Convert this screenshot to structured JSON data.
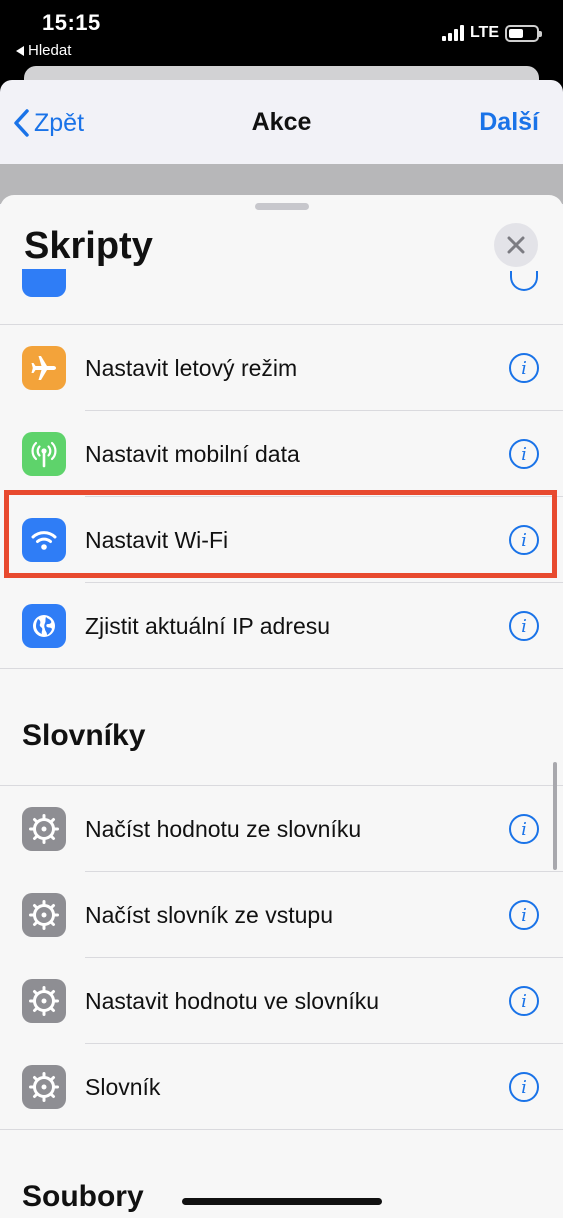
{
  "status_bar": {
    "time": "15:15",
    "back_app": "Hledat",
    "network": "LTE"
  },
  "nav": {
    "back_label": "Zpět",
    "title": "Akce",
    "next_label": "Další"
  },
  "sheet": {
    "title": "Skripty"
  },
  "sections": [
    {
      "items": [
        {
          "label": "Nastavit letový režim",
          "icon": "airplane-icon",
          "color": "#f3a33a"
        },
        {
          "label": "Nastavit mobilní data",
          "icon": "antenna-icon",
          "color": "#5ed36b"
        },
        {
          "label": "Nastavit Wi-Fi",
          "icon": "wifi-icon",
          "color": "#2f7df6"
        },
        {
          "label": "Zjistit aktuální IP adresu",
          "icon": "globe-icon",
          "color": "#2f7df6"
        }
      ]
    },
    {
      "header": "Slovníky",
      "items": [
        {
          "label": "Načíst hodnotu ze slovníku",
          "icon": "gear-icon",
          "color": "#8e8e93"
        },
        {
          "label": "Načíst slovník ze vstupu",
          "icon": "gear-icon",
          "color": "#8e8e93"
        },
        {
          "label": "Nastavit hodnotu ve slovníku",
          "icon": "gear-icon",
          "color": "#8e8e93"
        },
        {
          "label": "Slovník",
          "icon": "gear-icon",
          "color": "#8e8e93"
        }
      ]
    },
    {
      "header": "Soubory"
    }
  ],
  "info_glyph": "i"
}
